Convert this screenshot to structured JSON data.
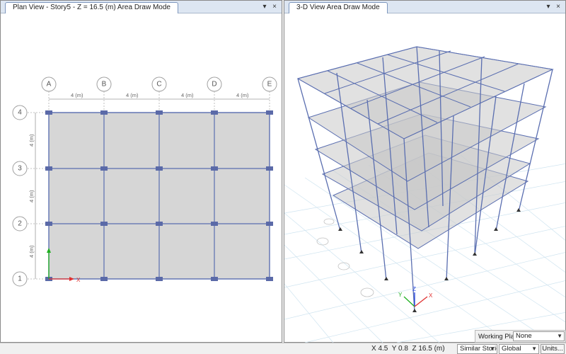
{
  "left_view": {
    "tab_title": "Plan View - Story5 - Z = 16.5 (m)  Area Draw Mode",
    "dropdown_icon": "▾",
    "close_icon": "×",
    "x_bubbles": [
      "A",
      "B",
      "C",
      "D",
      "E"
    ],
    "y_bubbles": [
      "4",
      "3",
      "2",
      "1"
    ],
    "x_spacings": [
      "4 (m)",
      "4 (m)",
      "4 (m)",
      "4 (m)"
    ],
    "y_spacings": [
      "4 (m)",
      "4 (m)",
      "4 (m)"
    ],
    "axis_x_label": "X"
  },
  "right_view": {
    "tab_title": "3-D View  Area Draw Mode",
    "dropdown_icon": "▾",
    "close_icon": "×",
    "axis_labels": {
      "x": "X",
      "y": "Y",
      "z": "Z"
    }
  },
  "working_plane": {
    "label": "Working Plane",
    "value": "None"
  },
  "status": {
    "coords": "X 4.5  Y 0.8  Z 16.5 (m)",
    "story_option": "Similar Stories",
    "coord_system": "Global",
    "units_button": "Units..."
  },
  "colors": {
    "grid": "#5a6eb0",
    "slab": "#c8c8c8",
    "x_axis": "#e03030",
    "y_axis": "#20b020",
    "z_axis": "#2040e0"
  }
}
